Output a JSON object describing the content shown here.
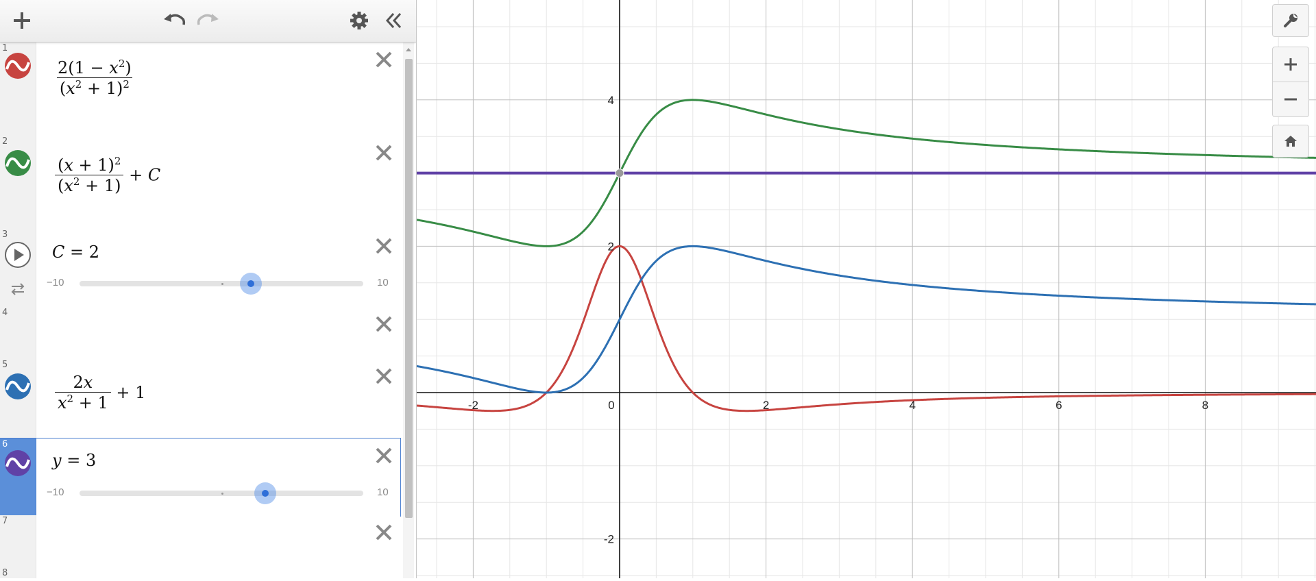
{
  "toolbar": {
    "add_icon": "plus-icon",
    "undo_icon": "undo-icon",
    "redo_icon": "redo-icon",
    "settings_icon": "gear-icon",
    "collapse_icon": "double-chevron-left-icon"
  },
  "expressions": [
    {
      "index": "1",
      "type": "function",
      "color": "#c74440",
      "latex": "2(1 − x²)/(x² + 1)²"
    },
    {
      "index": "2",
      "type": "function",
      "color": "#388c46",
      "latex": "(x + 1)²/(x² + 1) + C"
    },
    {
      "index": "3",
      "type": "slider",
      "text": "C = 2",
      "min": "−10",
      "max": "10",
      "value": 2
    },
    {
      "index": "4",
      "type": "empty"
    },
    {
      "index": "5",
      "type": "function",
      "color": "#2d70b3",
      "latex": "2x/(x² + 1) + 1"
    },
    {
      "index": "6",
      "type": "slider",
      "color": "#6042a6",
      "text": "y = 3",
      "min": "−10",
      "max": "10",
      "value": 3,
      "selected": true
    },
    {
      "index": "7",
      "type": "empty"
    },
    {
      "index": "8",
      "type": "empty"
    }
  ],
  "graph": {
    "x_ticks": [
      "-2",
      "0",
      "2",
      "4",
      "6",
      "8"
    ],
    "y_ticks": [
      "4",
      "2",
      "-2"
    ],
    "controls": [
      "wrench-icon",
      "zoom-in-icon",
      "zoom-out-icon",
      "home-icon"
    ],
    "colors": {
      "red": "#c74440",
      "green": "#388c46",
      "blue": "#2d70b3",
      "purple": "#6042a6"
    }
  },
  "text": {
    "e3_C": "C",
    "e3_eq": "=",
    "e3_val": "2",
    "e3_min": "−10",
    "e3_max": "10",
    "e6_y": "y",
    "e6_eq": "=",
    "e6_val": "3",
    "e6_min": "−10",
    "e6_max": "10",
    "idx": [
      "1",
      "2",
      "3",
      "4",
      "5",
      "6",
      "7",
      "8"
    ]
  }
}
